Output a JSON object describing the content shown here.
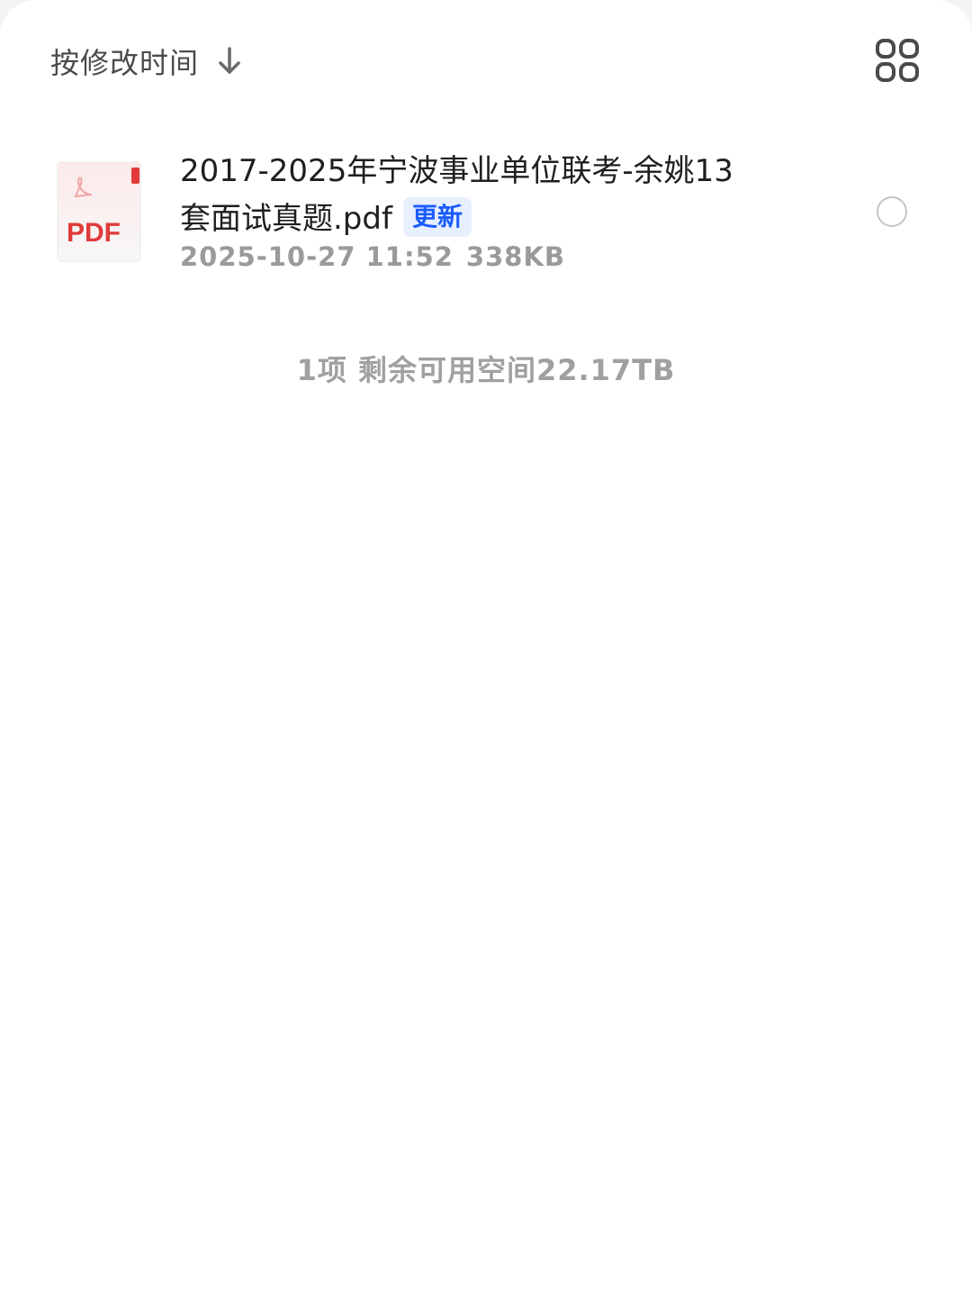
{
  "sort": {
    "label": "按修改时间",
    "direction_icon": "arrow-down-icon"
  },
  "view_toggle": {
    "icon": "grid-view-icon"
  },
  "files": [
    {
      "name": "2017-2025年宁波事业单位联考-余姚13套面试真题.pdf",
      "badge": "更新",
      "date": "2025-10-27 11:52",
      "size": "338KB",
      "type_icon": "pdf-file-icon",
      "type_label": "PDF",
      "selected": false
    }
  ],
  "footer": {
    "summary": "1项 剩余可用空间22.17TB"
  },
  "colors": {
    "pdf_red": "#e03a3a",
    "badge_blue": "#1a5cff",
    "badge_bg": "#e8efff",
    "meta_gray": "#9a9a9a"
  }
}
